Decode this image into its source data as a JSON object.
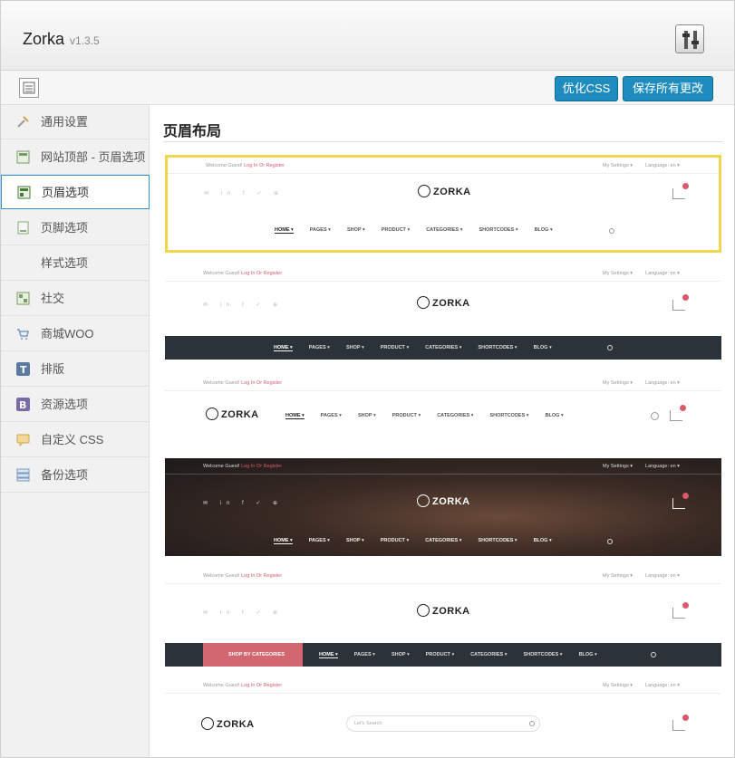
{
  "app": {
    "name": "Zorka",
    "version": "v1.3.5"
  },
  "toolbar": {
    "optimize_label": "优化CSS",
    "save_label": "保存所有更改"
  },
  "sidebar": {
    "items": [
      {
        "label": "通用设置",
        "icon": "wrench-icon"
      },
      {
        "label": "网站顶部 - 页眉选项",
        "icon": "layout-icon"
      },
      {
        "label": "页眉选项",
        "icon": "layout-icon"
      },
      {
        "label": "页脚选项",
        "icon": "page-icon"
      },
      {
        "label": "样式选项",
        "icon": ""
      },
      {
        "label": "社交",
        "icon": "social-icon"
      },
      {
        "label": "商城WOO",
        "icon": "cart-icon"
      },
      {
        "label": "排版",
        "icon": "typography-icon"
      },
      {
        "label": "资源选项",
        "icon": "bootstrap-icon"
      },
      {
        "label": "自定义 CSS",
        "icon": "comment-icon"
      },
      {
        "label": "备份选项",
        "icon": "backup-icon"
      }
    ]
  },
  "content": {
    "title": "页眉布局"
  },
  "layouts": {
    "welcome_prefix": "Welcome Guest!",
    "welcome_links": "Log In Or Register",
    "settings": "My Settings ▾",
    "language": "Language: en ▾",
    "logo": "ZORKA",
    "menu": [
      "HOME ▾",
      "PAGES ▾",
      "SHOP ▾",
      "PRODUCT ▾",
      "CATEGORIES ▾",
      "SHORTCODES ▾",
      "BLOG ▾"
    ],
    "shop_by_categories": "SHOP BY CATEGORIES",
    "search_placeholder": "Let's Search",
    "social": "✉ in f ✓ ⊕"
  },
  "colors": {
    "accent": "#1e8cbe",
    "highlight": "#f0d54d",
    "pink": "#d95b6b",
    "navbar": "#2b3238"
  }
}
